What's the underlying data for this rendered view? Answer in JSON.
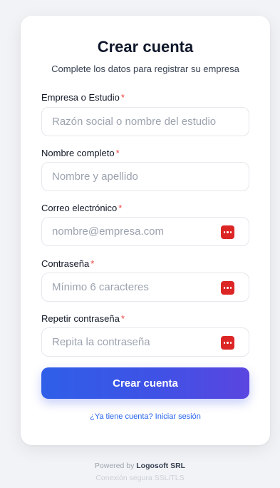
{
  "form": {
    "title": "Crear cuenta",
    "subtitle": "Complete los datos para registrar su empresa",
    "required_mark": "*",
    "fields": [
      {
        "label": "Empresa o Estudio",
        "placeholder": "Razón social o nombre del estudio",
        "value": "",
        "type": "text"
      },
      {
        "label": "Nombre completo",
        "placeholder": "Nombre y apellido",
        "value": "",
        "type": "text"
      },
      {
        "label": "Correo electrónico",
        "placeholder": "nombre@empresa.com",
        "value": "",
        "type": "email",
        "icon": "password-manager-icon"
      },
      {
        "label": "Contraseña",
        "placeholder": "Mínimo 6 caracteres",
        "value": "",
        "type": "password",
        "icon": "password-manager-icon"
      },
      {
        "label": "Repetir contraseña",
        "placeholder": "Repita la contraseña",
        "value": "",
        "type": "password",
        "icon": "password-manager-icon"
      }
    ],
    "submit_label": "Crear cuenta",
    "login_link": "¿Ya tiene cuenta? Iniciar sesión"
  },
  "footer": {
    "powered_prefix": "Powered by",
    "company": "Logosoft SRL",
    "secure": "Conexión segura SSL/TLS"
  },
  "colors": {
    "accent_start": "#2f5fe8",
    "accent_end": "#5b45e0",
    "required": "#ef4444",
    "icon_red": "#dc2626",
    "link": "#2563eb"
  }
}
